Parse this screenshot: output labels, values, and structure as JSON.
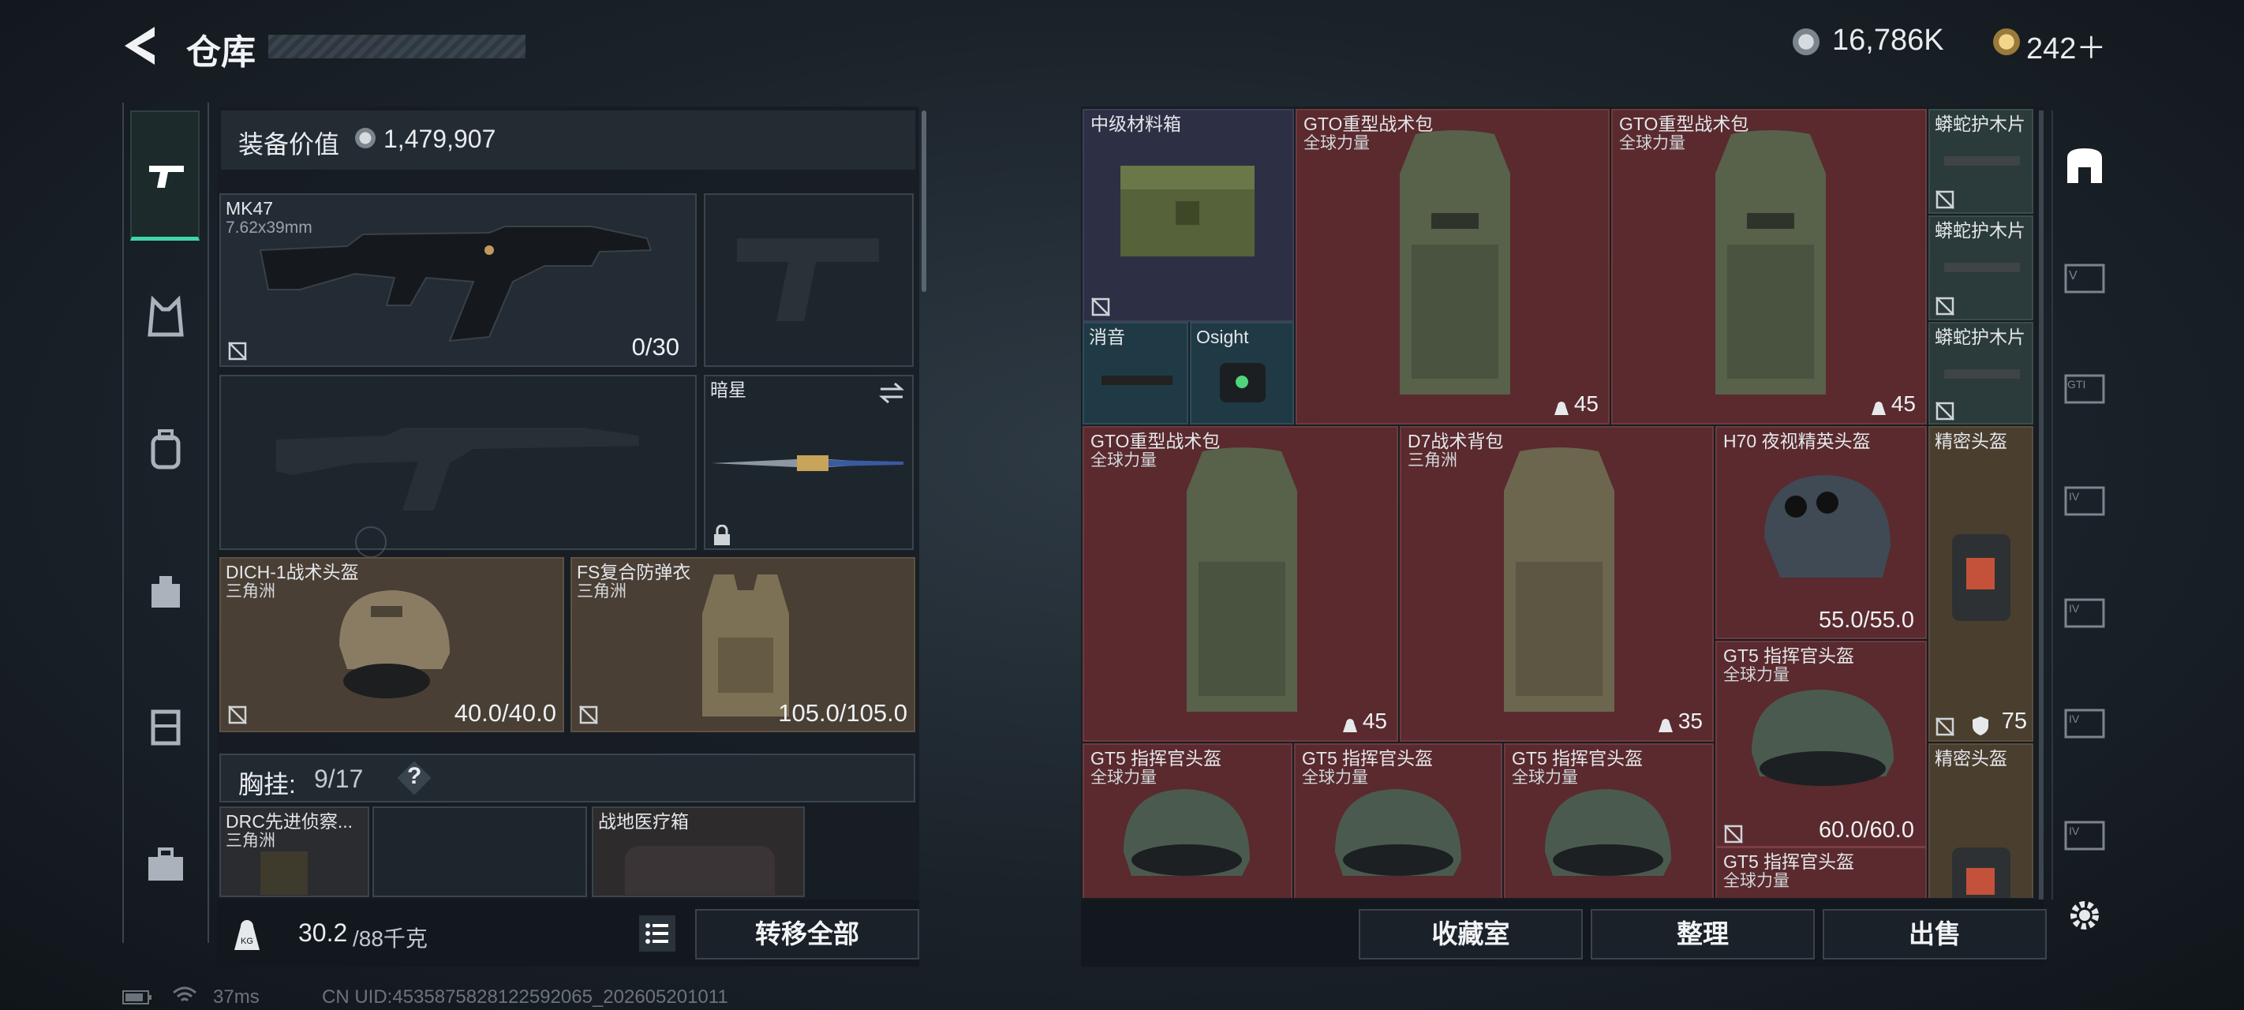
{
  "header": {
    "title": "仓库",
    "currency1": "16,786K",
    "currency2": "242＋"
  },
  "loadout": {
    "value_label": "装备价值",
    "value": "1,479,907",
    "primary_weapon": {
      "name": "MK47",
      "caliber": "7.62x39mm",
      "ammo": "0/30"
    },
    "melee": {
      "name": "暗星"
    },
    "helmet": {
      "name": "DICH-1战术头盔",
      "sub": "三角洲",
      "durability": "40.0/40.0"
    },
    "armor": {
      "name": "FS复合防弹衣",
      "sub": "三角洲",
      "durability": "105.0/105.0"
    },
    "rig_label": "胸挂:",
    "rig_count": "9/17",
    "rig_help": "?",
    "rig_items": [
      {
        "name": "DRC先进侦察...",
        "sub": "三角洲"
      },
      {
        "name": "",
        "sub": ""
      },
      {
        "name": "战地医疗箱",
        "sub": ""
      }
    ],
    "weight": "30.2",
    "weight_max": "/88千克",
    "transfer_all": "转移全部"
  },
  "stash": {
    "items": [
      {
        "name": "中级材料箱",
        "sub": ""
      },
      {
        "name": "GTO重型战术包",
        "sub": "全球力量",
        "count": "45"
      },
      {
        "name": "GTO重型战术包",
        "sub": "全球力量",
        "count": "45"
      },
      {
        "name": "蟒蛇护木片",
        "sub": ""
      },
      {
        "name": "蟒蛇护木片",
        "sub": ""
      },
      {
        "name": "蟒蛇护木片",
        "sub": ""
      },
      {
        "name": "消音",
        "sub": ""
      },
      {
        "name": "Osight",
        "sub": ""
      },
      {
        "name": "GTO重型战术包",
        "sub": "全球力量",
        "count": "45"
      },
      {
        "name": "D7战术背包",
        "sub": "三角洲",
        "count": "35"
      },
      {
        "name": "H70 夜视精英头盔",
        "sub": "",
        "durability": "55.0/55.0"
      },
      {
        "name": "精密头盔",
        "sub": "",
        "count": "75"
      },
      {
        "name": "GT5 指挥官头盔",
        "sub": "全球力量",
        "durability": "60.0/60.0"
      },
      {
        "name": "GT5 指挥官头盔",
        "sub": "全球力量"
      },
      {
        "name": "GT5 指挥官头盔",
        "sub": "全球力量"
      },
      {
        "name": "GT5 指挥官头盔",
        "sub": "全球力量"
      },
      {
        "name": "精密头盔",
        "sub": ""
      },
      {
        "name": "GT5 指挥官头盔",
        "sub": "全球力量"
      }
    ],
    "buttons": {
      "collection": "收藏室",
      "sort": "整理",
      "sell": "出售"
    }
  },
  "status": {
    "ping": "37ms",
    "uid": "CN UID:4535875828122592065_202605201011"
  },
  "colors": {
    "accent_green": "#3fd6a8",
    "slot_red": "#5a2a2e",
    "slot_brown": "#4a3f35"
  }
}
